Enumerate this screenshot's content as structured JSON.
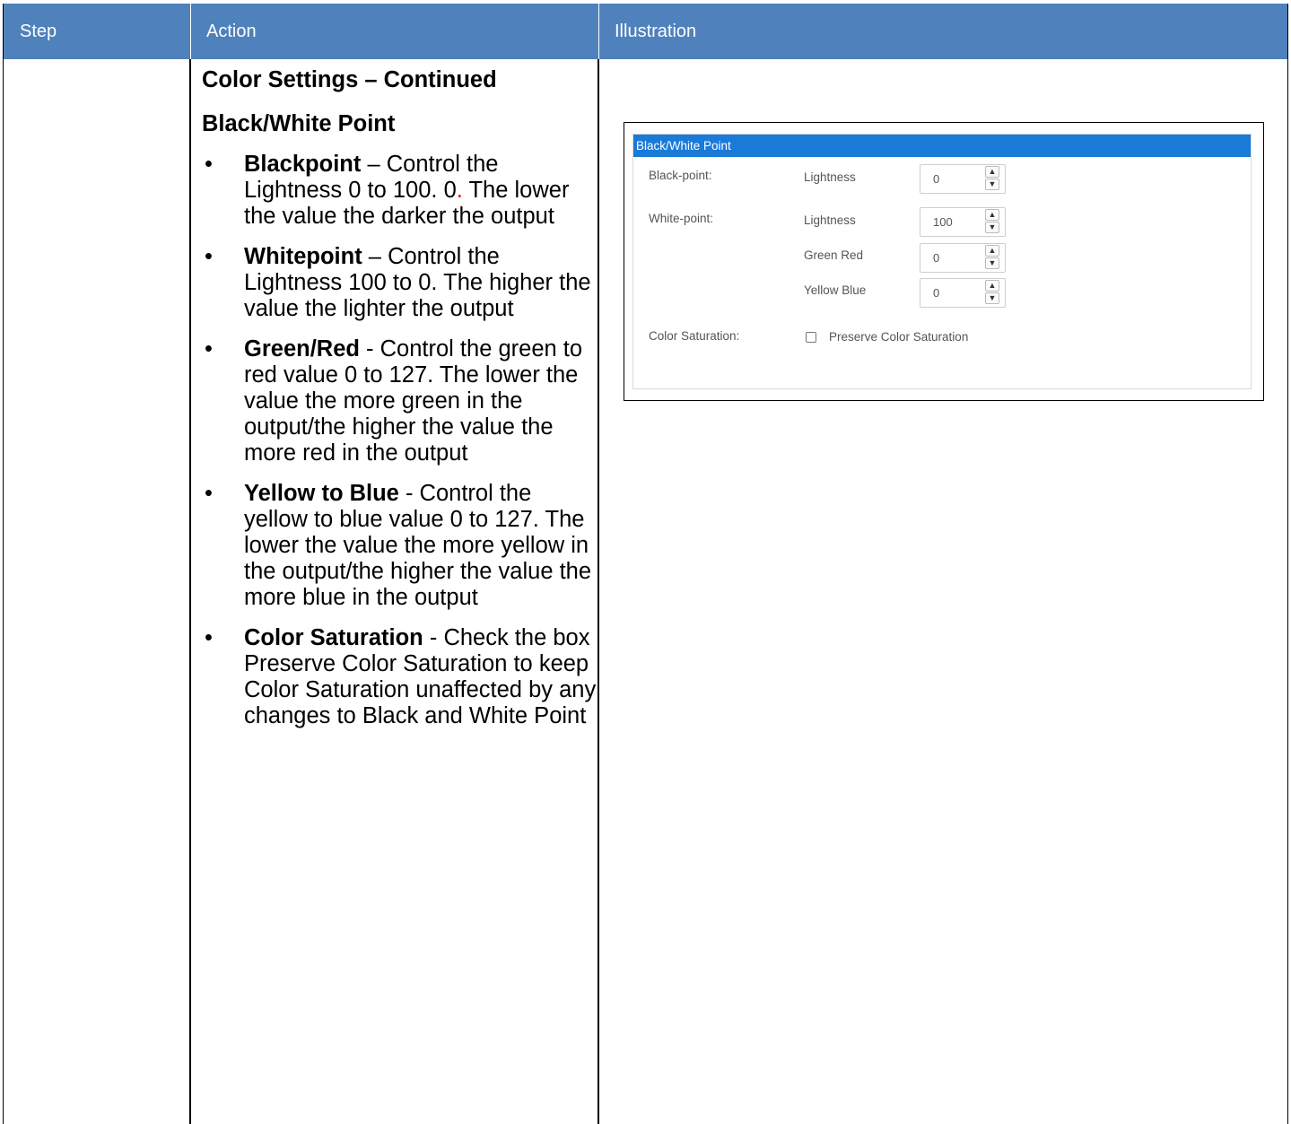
{
  "header": {
    "step": "Step",
    "action": "Action",
    "illustration": "Illustration"
  },
  "action": {
    "heading1": "Color Settings – Continued",
    "heading2": "Black/White Point",
    "bullets": [
      {
        "term": "Blackpoint",
        "sep": " – ",
        "text_a": "Control the Lightness 0 to 100. 0",
        "text_red": ".",
        "text_b": " The lower the value the darker the output"
      },
      {
        "term": "Whitepoint",
        "sep": " – ",
        "text": "Control the Lightness 100 to 0. The higher the value the lighter the output"
      },
      {
        "term": "Green/Red",
        "sep": " - ",
        "text": "Control the green to red value 0 to 127. The lower the value the more green in the output/the higher the value the more red in the output"
      },
      {
        "term": "Yellow to Blue",
        "sep": " - ",
        "text": "Control the yellow to blue value 0 to 127. The lower the value the more yellow in the output/the higher the value the more blue in the output"
      },
      {
        "term": "Color Saturation",
        "sep": " - ",
        "text": "Check the box Preserve Color Saturation to keep Color Saturation unaffected by any changes to Black and White Point"
      }
    ]
  },
  "illustration": {
    "panel_title": "Black/White Point",
    "black_point_label": "Black-point:",
    "white_point_label": "White-point:",
    "color_saturation_label": "Color Saturation:",
    "fields": [
      {
        "label": "Lightness",
        "value": "0"
      },
      {
        "label": "Lightness",
        "value": "100"
      },
      {
        "label": "Green Red",
        "value": "0"
      },
      {
        "label": "Yellow Blue",
        "value": "0"
      }
    ],
    "checkbox_label": "Preserve Color Saturation",
    "checkbox_checked": false
  },
  "colors": {
    "header_bg": "#4f81bd",
    "panel_header_bg": "#1a7ad8",
    "red_period": "#e00000"
  }
}
